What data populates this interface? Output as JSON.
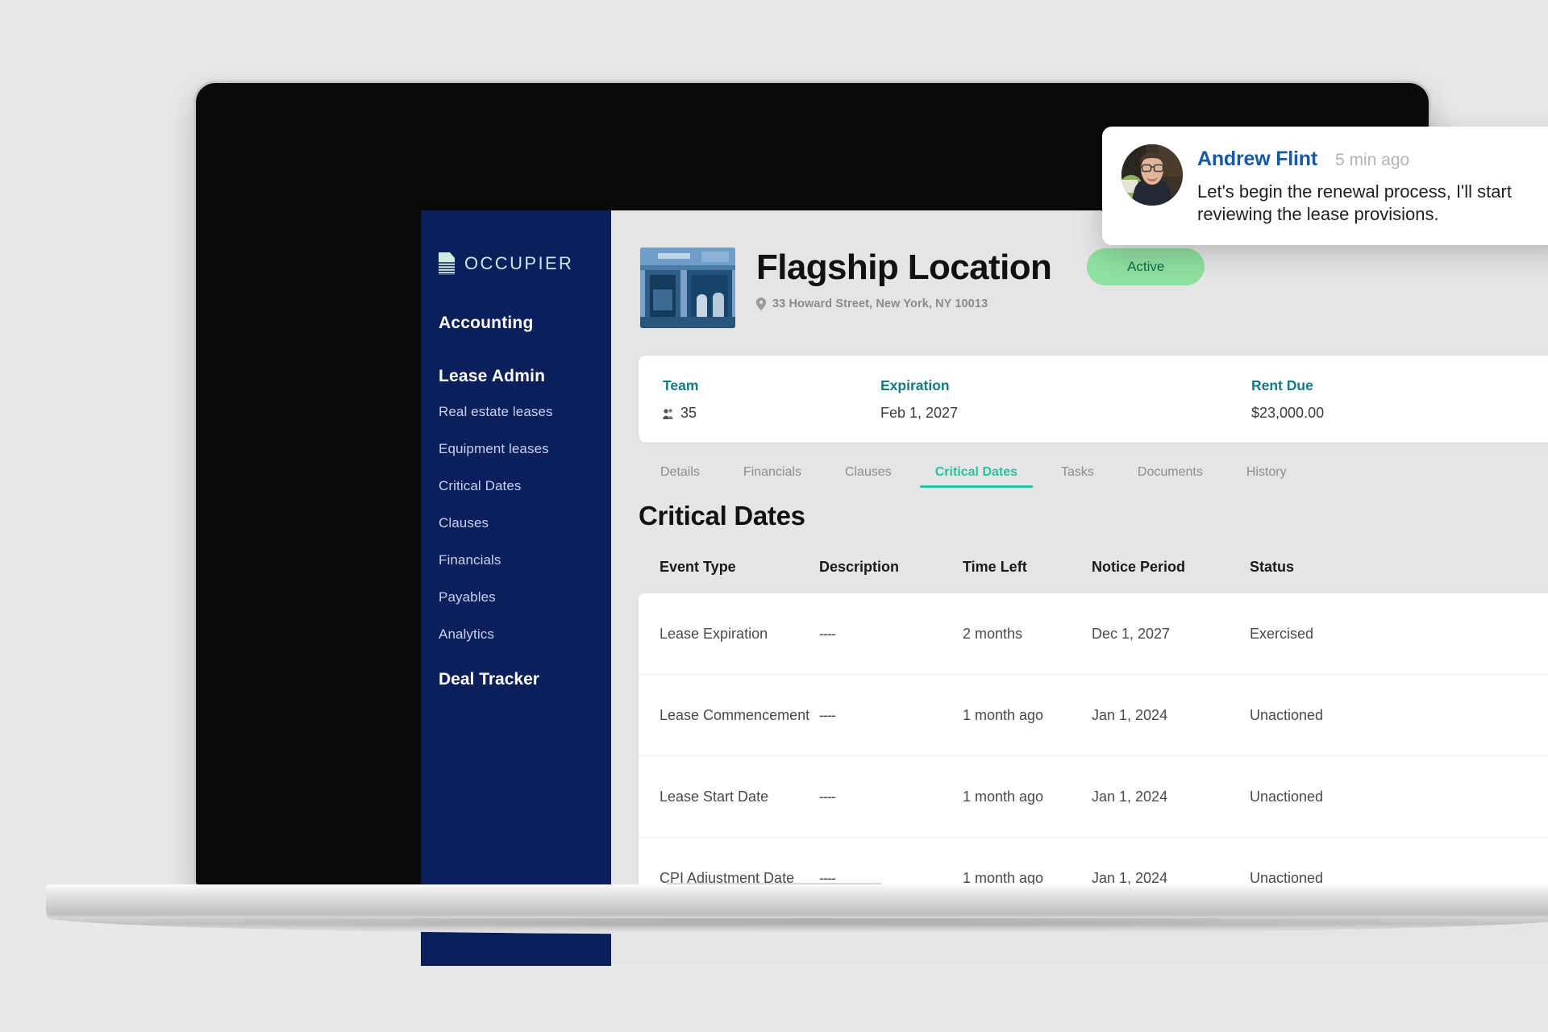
{
  "sidebar": {
    "brand": "OCCUPIER",
    "brand_icon": "document-logo-icon",
    "groups": [
      {
        "heading": "Accounting",
        "items": []
      },
      {
        "heading": "Lease Admin",
        "items": [
          "Real estate leases",
          "Equipment leases",
          "Critical Dates",
          "Clauses",
          "Financials",
          "Payables",
          "Analytics"
        ]
      }
    ],
    "footer_heading": "Deal Tracker"
  },
  "header": {
    "thumbnail_alt": "storefront-photo",
    "title": "Flagship Location",
    "status": "Active",
    "address": "33 Howard Street, New York, NY 10013",
    "address_icon": "location-pin-icon"
  },
  "stats": [
    {
      "label": "Team",
      "value": "35",
      "icon": "people-icon"
    },
    {
      "label": "Expiration",
      "value": "Feb 1, 2027",
      "icon": ""
    },
    {
      "label": "Rent Due",
      "value": "$23,000.00",
      "icon": ""
    }
  ],
  "tabs": [
    {
      "label": "Details",
      "active": false
    },
    {
      "label": "Financials",
      "active": false
    },
    {
      "label": "Clauses",
      "active": false
    },
    {
      "label": "Critical Dates",
      "active": true
    },
    {
      "label": "Tasks",
      "active": false
    },
    {
      "label": "Documents",
      "active": false
    },
    {
      "label": "History",
      "active": false
    }
  ],
  "section_title": "Critical Dates",
  "table": {
    "columns": [
      "Event Type",
      "Description",
      "Time Left",
      "Notice Period",
      "Status"
    ],
    "rows": [
      {
        "event_type": "Lease Expiration",
        "description": "----",
        "time_left": "2 months",
        "notice_period": "Dec 1, 2027",
        "status": "Exercised"
      },
      {
        "event_type": "Lease Commencement",
        "description": "----",
        "time_left": "1 month ago",
        "notice_period": "Jan 1, 2024",
        "status": "Unactioned"
      },
      {
        "event_type": "Lease Start Date",
        "description": "----",
        "time_left": "1 month ago",
        "notice_period": "Jan 1, 2024",
        "status": "Unactioned"
      },
      {
        "event_type": "CPI Adjustment Date",
        "description": "----",
        "time_left": "1 month ago",
        "notice_period": "Jan 1, 2024",
        "status": "Unactioned"
      }
    ]
  },
  "toast": {
    "avatar_alt": "user-avatar-photo",
    "name": "Andrew Flint",
    "time": "5 min ago",
    "message": "Let's begin the renewal process, I'll start reviewing the lease provisions."
  },
  "colors": {
    "sidebar_bg": "#0b1f5c",
    "brand_text": "#c9e8dd",
    "accent_teal": "#27c2a0",
    "stat_label": "#117a87",
    "badge_bg": "#8fdfa0",
    "badge_text": "#0e6b4a",
    "toast_name": "#1558a8",
    "page_bg": "#e5e5e5"
  }
}
